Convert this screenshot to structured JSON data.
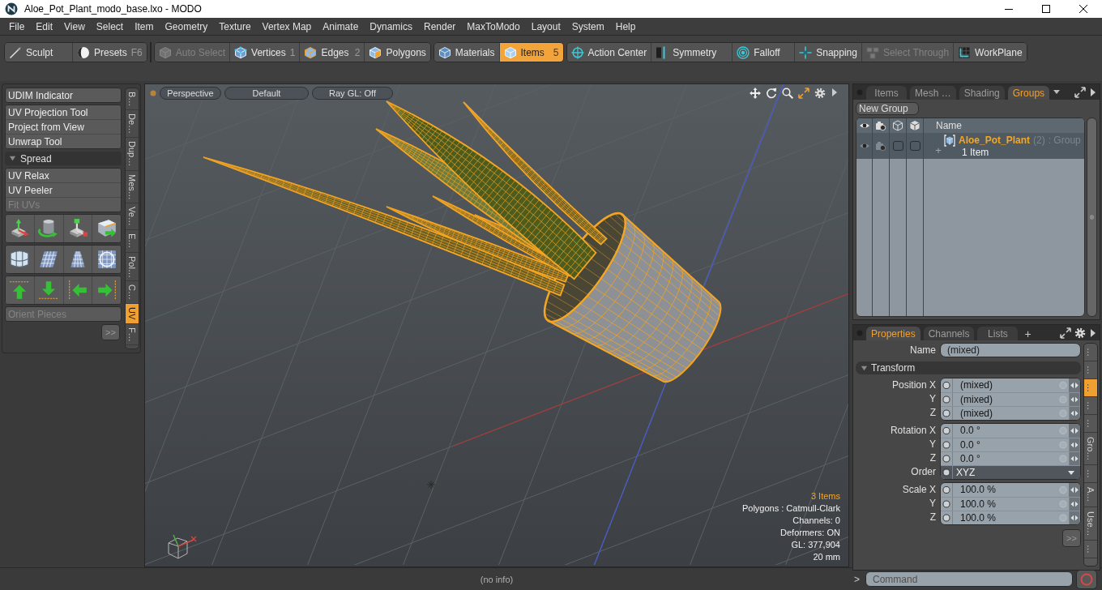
{
  "window": {
    "title": "Aloe_Pot_Plant_modo_base.lxo - MODO"
  },
  "menu": [
    "File",
    "Edit",
    "View",
    "Select",
    "Item",
    "Geometry",
    "Texture",
    "Vertex Map",
    "Animate",
    "Dynamics",
    "Render",
    "MaxToModo",
    "Layout",
    "System",
    "Help"
  ],
  "toolbar": [
    {
      "items": [
        {
          "label": "Sculpt",
          "selected": false,
          "disabled": false
        },
        {
          "label": "Presets",
          "shortcut": "F6",
          "selected": false,
          "disabled": false
        }
      ]
    },
    {
      "items": [
        {
          "label": "Auto Select",
          "selected": false,
          "disabled": true
        },
        {
          "label": "Vertices",
          "shortcut": "1",
          "selected": false,
          "disabled": false
        },
        {
          "label": "Edges",
          "shortcut": "2",
          "selected": false,
          "disabled": false
        },
        {
          "label": "Polygons",
          "selected": false,
          "disabled": false
        }
      ]
    },
    {
      "items": [
        {
          "label": "Materials",
          "selected": false,
          "disabled": false
        },
        {
          "label": "Items",
          "shortcut": "5",
          "selected": true,
          "disabled": false
        }
      ]
    },
    {
      "items": [
        {
          "label": "Action Center",
          "selected": false,
          "disabled": false
        },
        {
          "label": "Symmetry",
          "selected": false,
          "disabled": false
        },
        {
          "label": "Falloff",
          "selected": false,
          "disabled": false
        },
        {
          "label": "Snapping",
          "selected": false,
          "disabled": false
        },
        {
          "label": "Select Through",
          "selected": false,
          "disabled": true
        },
        {
          "label": "WorkPlane",
          "selected": false,
          "disabled": false
        }
      ]
    }
  ],
  "tool_panel": {
    "sections": [
      {
        "kind": "list",
        "items": [
          {
            "label": "UDIM Indicator",
            "disabled": false
          }
        ]
      },
      {
        "kind": "list",
        "items": [
          {
            "label": "UV Projection Tool",
            "disabled": false
          },
          {
            "label": "Project from View",
            "disabled": false
          },
          {
            "label": "Unwrap Tool",
            "disabled": false
          }
        ]
      },
      {
        "kind": "header",
        "label": "Spread",
        "expanded": true
      },
      {
        "kind": "list",
        "items": [
          {
            "label": "UV Relax",
            "disabled": false
          },
          {
            "label": "UV Peeler",
            "disabled": false
          },
          {
            "label": "Fit UVs",
            "disabled": true
          }
        ]
      },
      {
        "kind": "icons"
      },
      {
        "kind": "icons"
      },
      {
        "kind": "icons"
      },
      {
        "kind": "list",
        "items": [
          {
            "label": "Orient Pieces",
            "disabled": true
          }
        ]
      },
      {
        "kind": "more",
        "label": ">>"
      }
    ],
    "tabs": [
      {
        "label": "B…",
        "selected": false
      },
      {
        "label": "De…",
        "selected": false
      },
      {
        "label": "Dup…",
        "selected": false
      },
      {
        "label": "Mes…",
        "selected": false
      },
      {
        "label": "Ve…",
        "selected": false
      },
      {
        "label": "E…",
        "selected": false
      },
      {
        "label": "Pol…",
        "selected": false
      },
      {
        "label": "C…",
        "selected": false
      },
      {
        "label": "UV",
        "selected": true
      },
      {
        "label": "F…",
        "selected": false
      }
    ]
  },
  "viewport": {
    "options": [
      "Perspective",
      "Default",
      "Ray GL: Off"
    ],
    "info": [
      {
        "text": "3 Items",
        "highlight": true
      },
      {
        "text": "Polygons : Catmull-Clark",
        "highlight": false
      },
      {
        "text": "Channels: 0",
        "highlight": false
      },
      {
        "text": "Deformers: ON",
        "highlight": false
      },
      {
        "text": "GL: 377,904",
        "highlight": false
      },
      {
        "text": "20 mm",
        "highlight": false
      }
    ]
  },
  "groups_panel": {
    "tabs": [
      {
        "label": "Items",
        "selected": false
      },
      {
        "label": "Mesh …",
        "selected": false
      },
      {
        "label": "Shading",
        "selected": false
      },
      {
        "label": "Groups",
        "selected": true
      }
    ],
    "new_button": "New Group",
    "column": "Name",
    "rows": [
      {
        "expander": "+",
        "name": "Aloe_Pot_Plant",
        "count": "(2)",
        "type": ": Group",
        "detail": "1 Item",
        "toggles": [
          {
            "checked": false
          },
          {
            "checked": false
          }
        ]
      }
    ]
  },
  "properties": {
    "tabs": [
      {
        "label": "Properties",
        "selected": true
      },
      {
        "label": "Channels",
        "selected": false
      },
      {
        "label": "Lists",
        "selected": false
      }
    ],
    "add_tab": "+",
    "name_field": {
      "label": "Name",
      "value": "(mixed)"
    },
    "section": {
      "label": "Transform",
      "expanded": true
    },
    "groups": [
      {
        "rows": [
          {
            "kind": "vector",
            "label": "Position X",
            "value": "(mixed)"
          },
          {
            "kind": "vector",
            "label": "Y",
            "value": "(mixed)"
          },
          {
            "kind": "vector",
            "label": "Z",
            "value": "(mixed)"
          }
        ]
      },
      {
        "rows": [
          {
            "kind": "vector",
            "label": "Rotation X",
            "value": "0.0 °"
          },
          {
            "kind": "vector",
            "label": "Y",
            "value": "0.0 °"
          },
          {
            "kind": "vector",
            "label": "Z",
            "value": "0.0 °"
          },
          {
            "kind": "dropdown",
            "label": "Order",
            "value": "XYZ"
          }
        ]
      },
      {
        "rows": [
          {
            "kind": "vector",
            "label": "Scale X",
            "value": "100.0 %"
          },
          {
            "kind": "vector",
            "label": "Y",
            "value": "100.0 %"
          },
          {
            "kind": "vector",
            "label": "Z",
            "value": "100.0 %"
          }
        ]
      }
    ],
    "more": ">>",
    "side_tabs": [
      {
        "label": "…",
        "selected": false
      },
      {
        "label": "…",
        "selected": false
      },
      {
        "label": "…",
        "selected": true
      },
      {
        "label": "…",
        "selected": false
      },
      {
        "label": "…",
        "selected": false
      },
      {
        "label": "Gro…",
        "selected": false
      },
      {
        "label": "…",
        "selected": false
      },
      {
        "label": "A…",
        "selected": false
      },
      {
        "label": "Use…",
        "selected": false
      },
      {
        "label": "…",
        "selected": false
      }
    ]
  },
  "status_bar": {
    "info": "(no info)",
    "prompt": ">",
    "command": {
      "placeholder": "Command"
    }
  }
}
